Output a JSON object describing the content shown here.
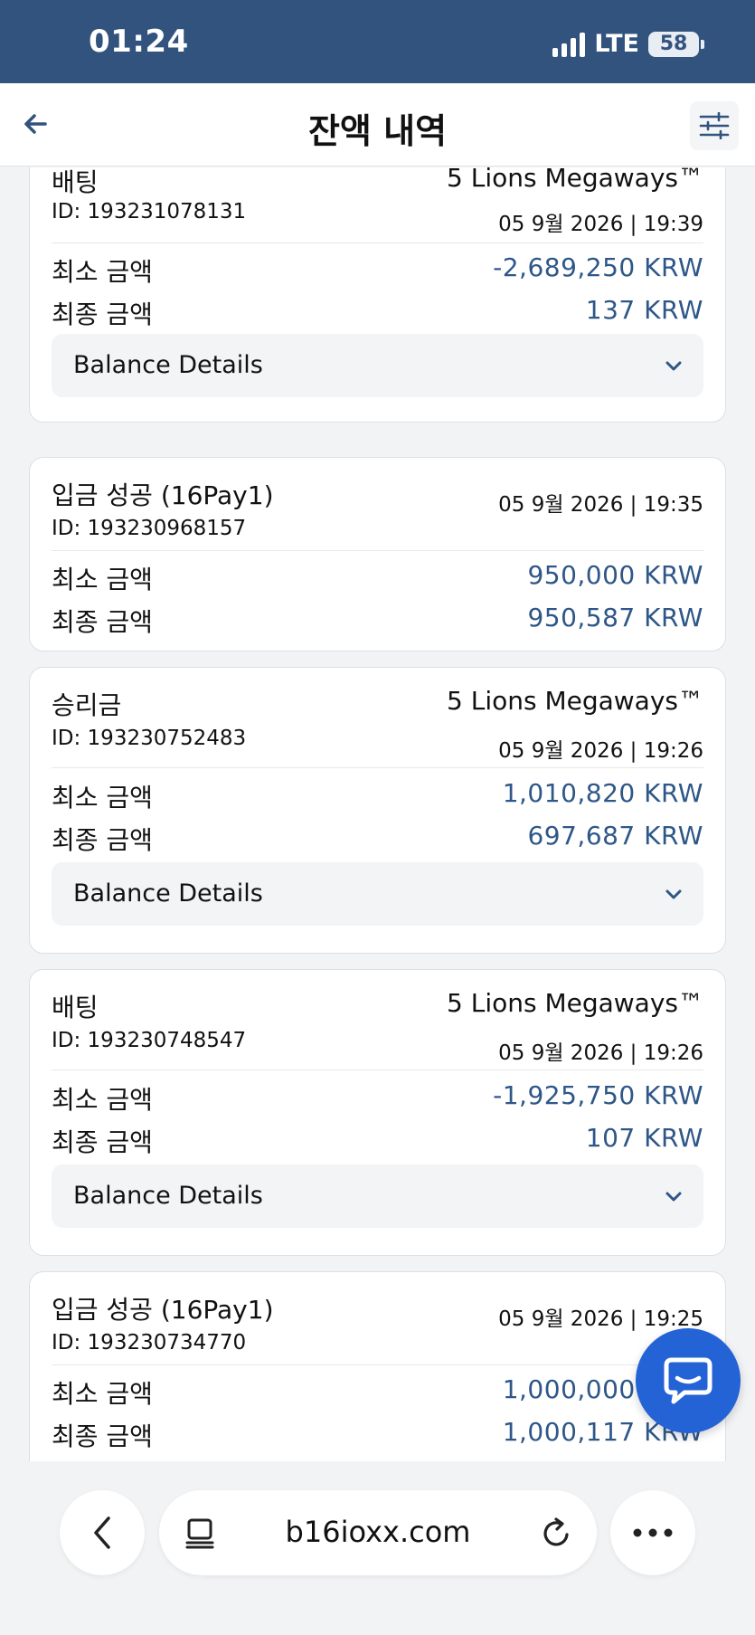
{
  "status_bar": {
    "time": "01:24",
    "network": "LTE",
    "battery": "58"
  },
  "header": {
    "title": "잔액 내역"
  },
  "transactions": [
    {
      "type": "배팅",
      "game": "5 Lions Megaways™",
      "id": "ID: 193231078131",
      "date": "05 9월 2026 | 19:39",
      "min_label": "최소 금액",
      "min_value": "-2,689,250 KRW",
      "final_label": "최종 금액",
      "final_value": "137 KRW",
      "details_label": "Balance Details"
    },
    {
      "type": "입금 성공 (16Pay1)",
      "game": "",
      "id": "ID: 193230968157",
      "date": "05 9월 2026 | 19:35",
      "min_label": "최소 금액",
      "min_value": "950,000 KRW",
      "final_label": "최종 금액",
      "final_value": "950,587 KRW",
      "details_label": ""
    },
    {
      "type": "승리금",
      "game": "5 Lions Megaways™",
      "id": "ID: 193230752483",
      "date": "05 9월 2026 | 19:26",
      "min_label": "최소 금액",
      "min_value": "1,010,820 KRW",
      "final_label": "최종 금액",
      "final_value": "697,687 KRW",
      "details_label": "Balance Details"
    },
    {
      "type": "배팅",
      "game": "5 Lions Megaways™",
      "id": "ID: 193230748547",
      "date": "05 9월 2026 | 19:26",
      "min_label": "최소 금액",
      "min_value": "-1,925,750 KRW",
      "final_label": "최종 금액",
      "final_value": "107 KRW",
      "details_label": "Balance Details"
    },
    {
      "type": "입금 성공 (16Pay1)",
      "game": "",
      "id": "ID: 193230734770",
      "date": "05 9월 2026 | 19:25",
      "min_label": "최소 금액",
      "min_value": "1,000,000 KRW",
      "final_label": "최종 금액",
      "final_value": "1,000,117 KRW",
      "details_label": ""
    }
  ],
  "browser": {
    "url": "b16ioxx.com"
  },
  "colors": {
    "status_bar": "#32537e",
    "amount": "#2e5788",
    "chat": "#2463d6"
  }
}
